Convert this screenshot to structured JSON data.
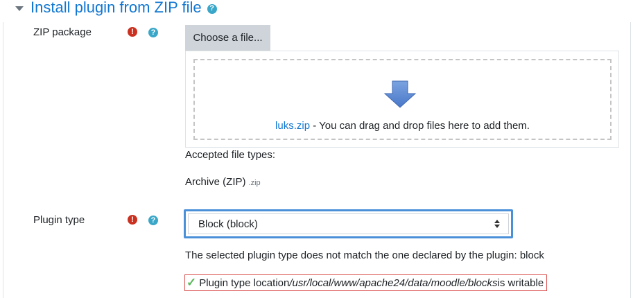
{
  "section": {
    "title": "Install plugin from ZIP file"
  },
  "zip_field": {
    "label": "ZIP package",
    "choose_button": "Choose a file...",
    "file_name": "luks.zip",
    "drop_hint": " - You can drag and drop files here to add them.",
    "accepted_heading": "Accepted file types:",
    "accepted_type": "Archive (ZIP)",
    "accepted_ext": ".zip"
  },
  "plugin_type_field": {
    "label": "Plugin type",
    "selected": "Block (block)",
    "mismatch_message": "The selected plugin type does not match the one declared by the plugin: block",
    "location_prefix": "Plugin type location ",
    "location_path": "/usr/local/www/apache24/data/moodle/blocks",
    "location_suffix": " is writable"
  },
  "icons": {
    "required": "exclamation-circle-icon",
    "help": "question-circle-icon",
    "collapse": "caret-down-icon",
    "upload": "down-arrow-icon",
    "writable": "check-icon"
  },
  "colors": {
    "link": "#1177d1",
    "required": "#ca3120",
    "help": "#3aa7c8",
    "focus": "#4a90d9",
    "ok": "#5cb85c",
    "highlight": "#d9534f"
  }
}
